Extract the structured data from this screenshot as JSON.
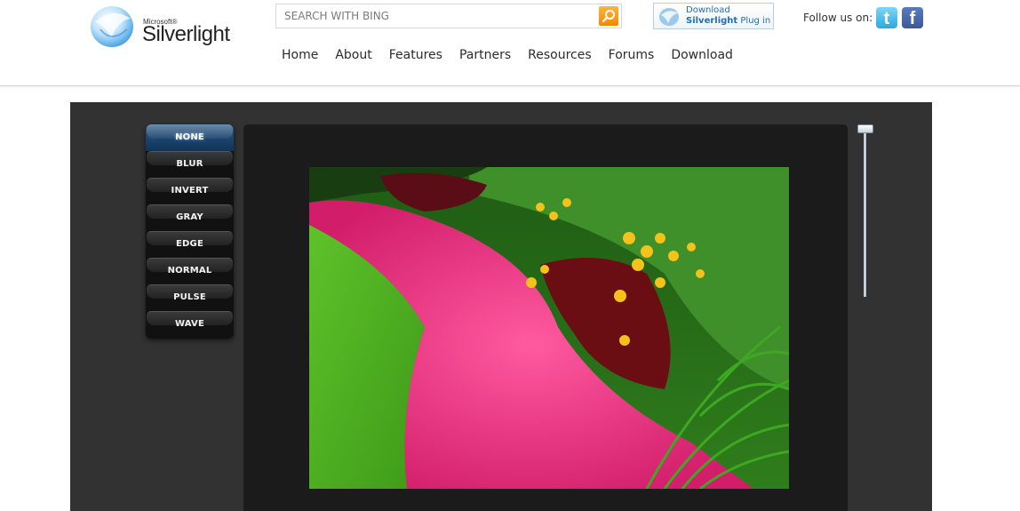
{
  "header": {
    "logo": {
      "brand_small": "Microsoft®",
      "brand_large": "Silverlight",
      "icon": "silverlight-orb-icon"
    },
    "search": {
      "placeholder": "SEARCH WITH BING",
      "value": "",
      "button_icon": "search-icon"
    },
    "download_badge": {
      "line1": "Download",
      "line2_bold": "Silverlight",
      "line2_rest": " Plug in",
      "icon": "silverlight-orb-icon"
    },
    "follow": {
      "label": "Follow us on:",
      "twitter_icon": "twitter-icon",
      "facebook_icon": "facebook-icon"
    },
    "nav": [
      {
        "label": "Home"
      },
      {
        "label": "About"
      },
      {
        "label": "Features"
      },
      {
        "label": "Partners"
      },
      {
        "label": "Resources"
      },
      {
        "label": "Forums"
      },
      {
        "label": "Download"
      }
    ]
  },
  "stage": {
    "effects": [
      {
        "label": "NONE",
        "active": true
      },
      {
        "label": "BLUR",
        "active": false
      },
      {
        "label": "INVERT",
        "active": false
      },
      {
        "label": "GRAY",
        "active": false
      },
      {
        "label": "EDGE",
        "active": false
      },
      {
        "label": "NORMAL",
        "active": false
      },
      {
        "label": "PULSE",
        "active": false
      },
      {
        "label": "WAVE",
        "active": false
      }
    ],
    "image": {
      "description": "Flower garden with pink begonias, yellow black-eyed susans, red coleus and green lawn"
    },
    "slider": {
      "value_fraction": 0.0
    },
    "colors": {
      "active_effect": "#1f4a75",
      "stage_bg": "#323232",
      "viewer_bg": "#1b1b1b"
    }
  }
}
